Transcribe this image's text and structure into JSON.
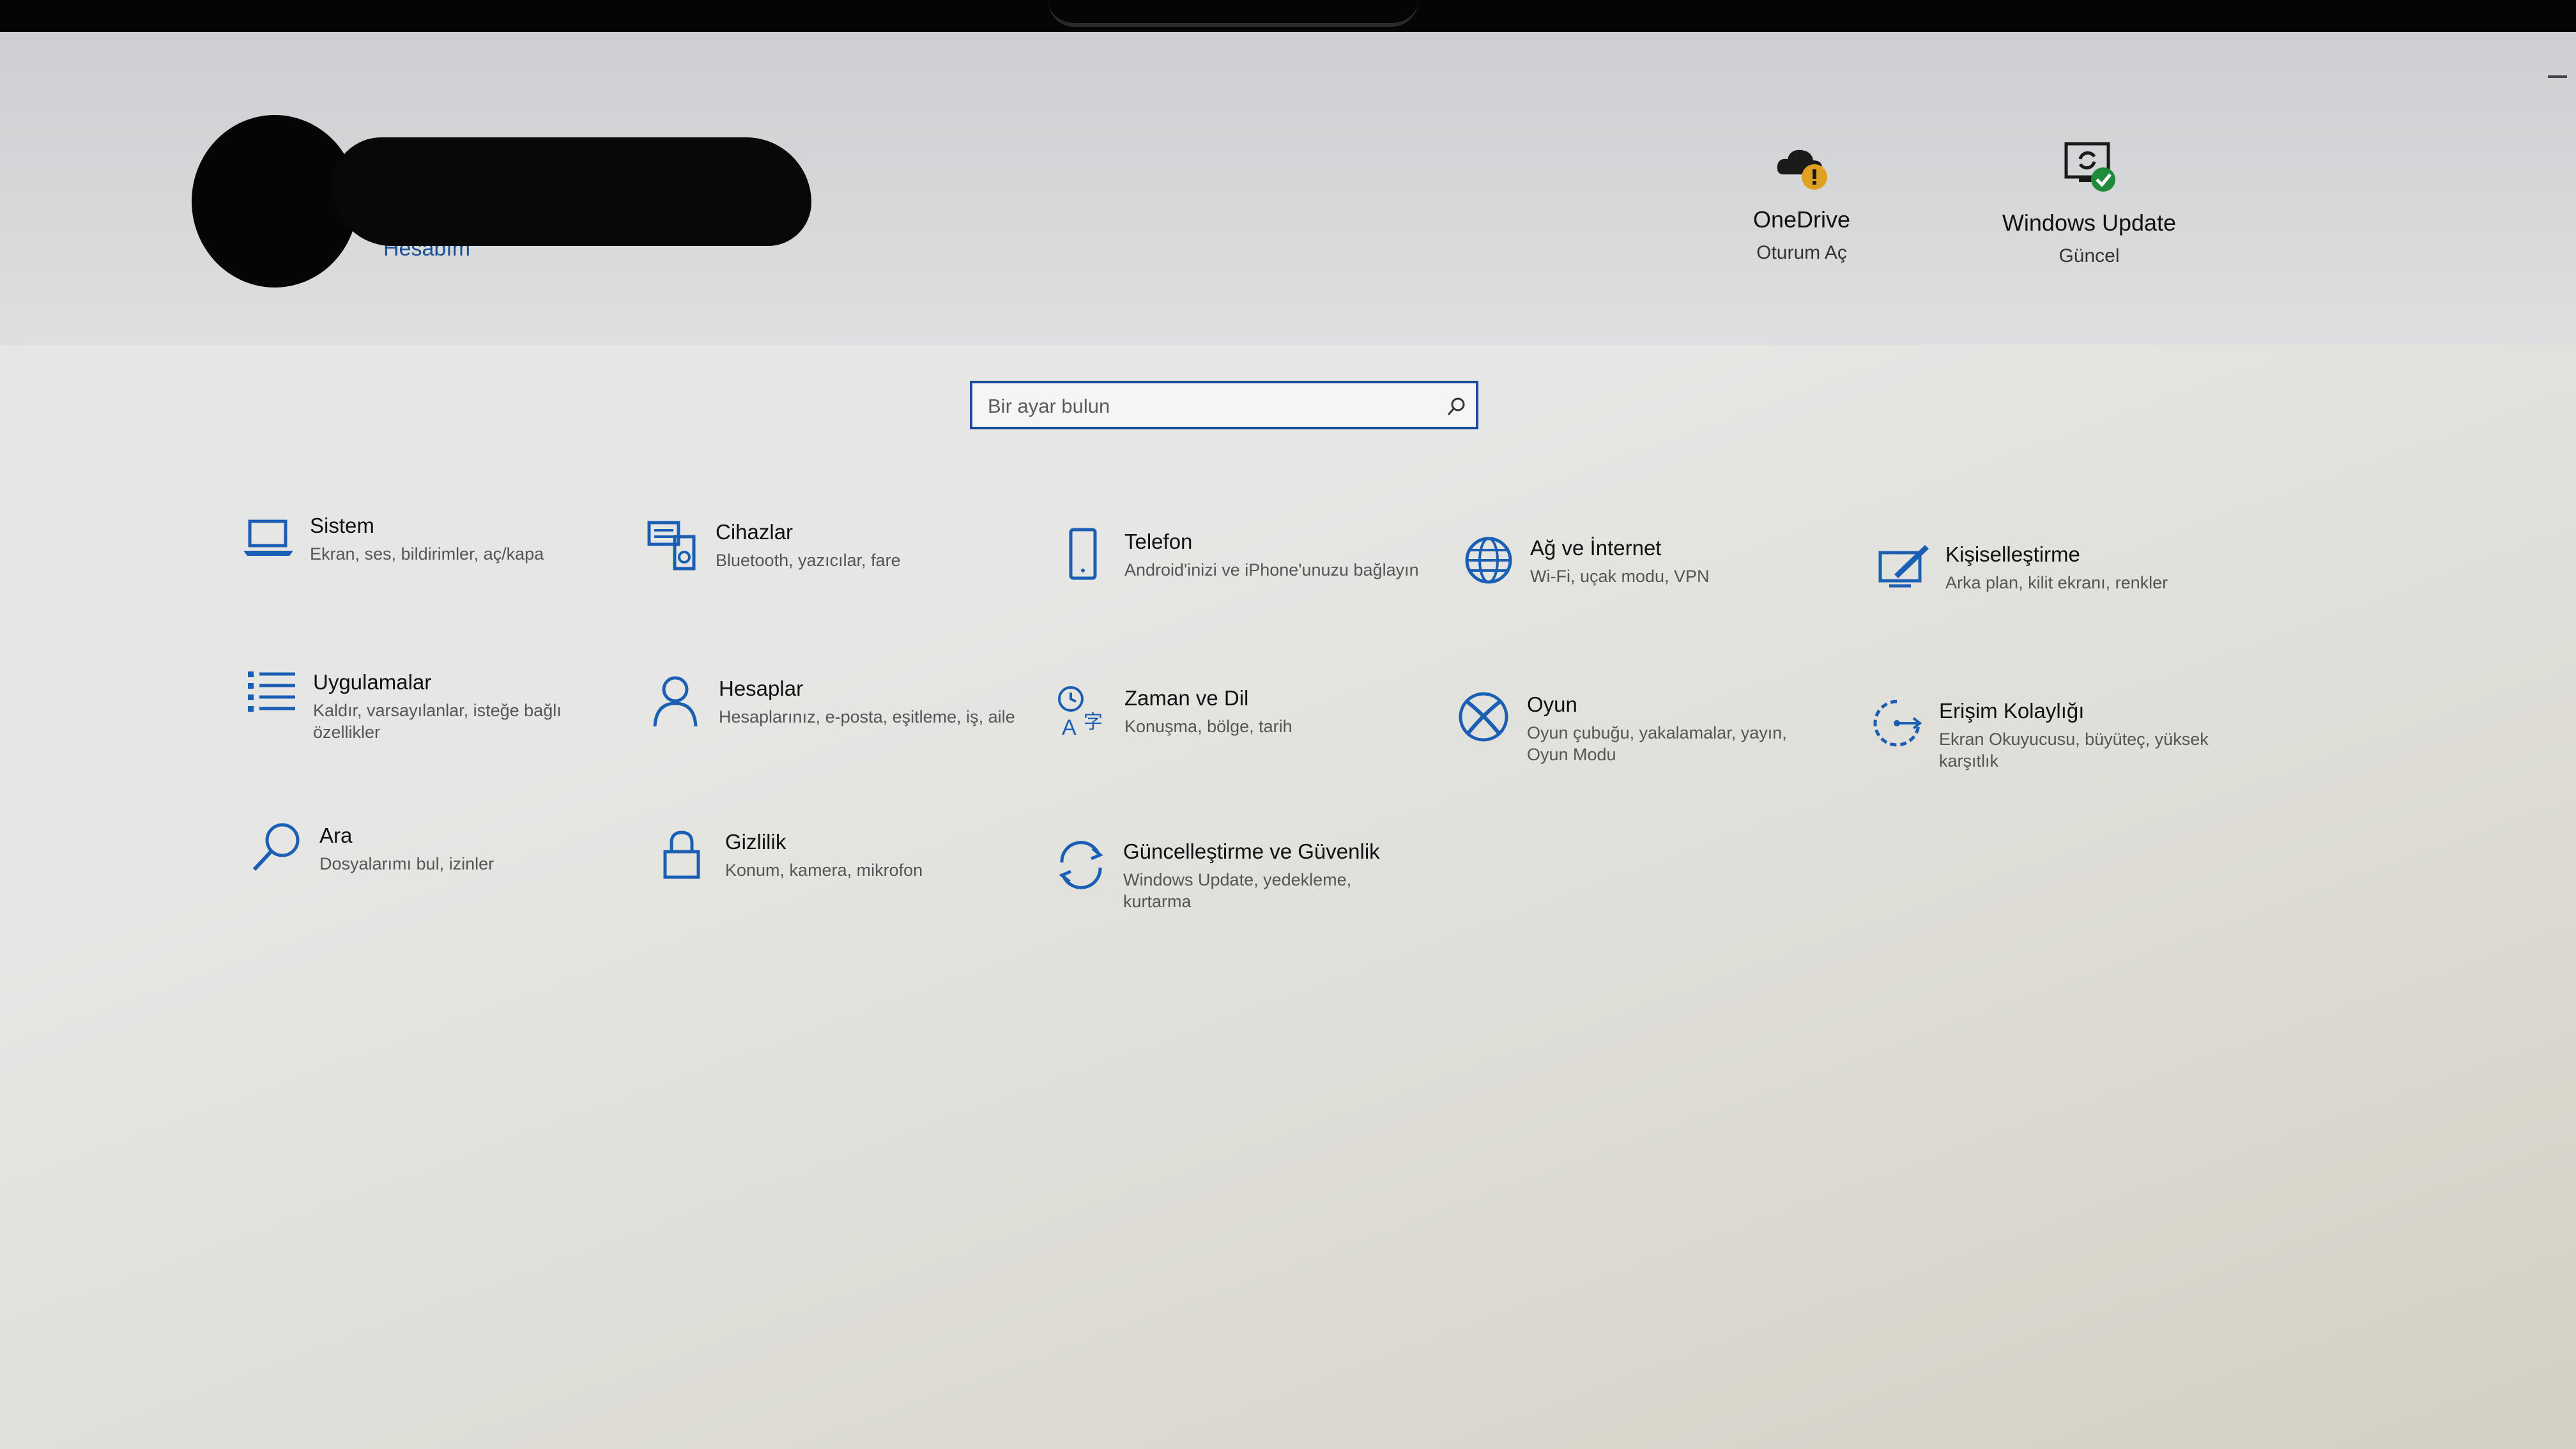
{
  "account": {
    "link_label": "Hesabım"
  },
  "status": [
    {
      "title": "OneDrive",
      "subtitle": "Oturum Aç",
      "icon": "onedrive-warning-icon"
    },
    {
      "title": "Windows Update",
      "subtitle": "Güncel",
      "icon": "windows-update-check-icon"
    }
  ],
  "search": {
    "placeholder": "Bir ayar bulun",
    "icon": "search-icon"
  },
  "tiles": [
    {
      "title": "Sistem",
      "desc": "Ekran, ses, bildirimler, aç/kapa",
      "icon": "laptop-icon"
    },
    {
      "title": "Cihazlar",
      "desc": "Bluetooth, yazıcılar, fare",
      "icon": "devices-icon"
    },
    {
      "title": "Telefon",
      "desc": "Android'inizi ve iPhone'unuzu bağlayın",
      "icon": "phone-icon"
    },
    {
      "title": "Ağ ve İnternet",
      "desc": "Wi-Fi, uçak modu, VPN",
      "icon": "globe-icon"
    },
    {
      "title": "Kişiselleştirme",
      "desc": "Arka plan, kilit ekranı, renkler",
      "icon": "personalization-icon"
    },
    {
      "title": "Uygulamalar",
      "desc": "Kaldır, varsayılanlar, isteğe bağlı özellikler",
      "icon": "apps-list-icon"
    },
    {
      "title": "Hesaplar",
      "desc": "Hesaplarınız, e-posta, eşitleme, iş, aile",
      "icon": "person-icon"
    },
    {
      "title": "Zaman ve Dil",
      "desc": "Konuşma, bölge, tarih",
      "icon": "time-language-icon"
    },
    {
      "title": "Oyun",
      "desc": "Oyun çubuğu, yakalamalar, yayın, Oyun Modu",
      "icon": "xbox-icon"
    },
    {
      "title": "Erişim Kolaylığı",
      "desc": "Ekran Okuyucusu, büyüteç, yüksek karşıtlık",
      "icon": "ease-of-access-icon"
    },
    {
      "title": "Ara",
      "desc": "Dosyalarımı bul, izinler",
      "icon": "search-magnifier-icon"
    },
    {
      "title": "Gizlilik",
      "desc": "Konum, kamera, mikrofon",
      "icon": "lock-icon"
    },
    {
      "title": "Güncelleştirme ve Güvenlik",
      "desc": "Windows Update, yedekleme, kurtarma",
      "icon": "update-sync-icon"
    }
  ],
  "colors": {
    "accent": "#1b4a9c",
    "icon_blue": "#1a5fb4",
    "warning": "#e0a020",
    "success": "#1e8a3a"
  }
}
